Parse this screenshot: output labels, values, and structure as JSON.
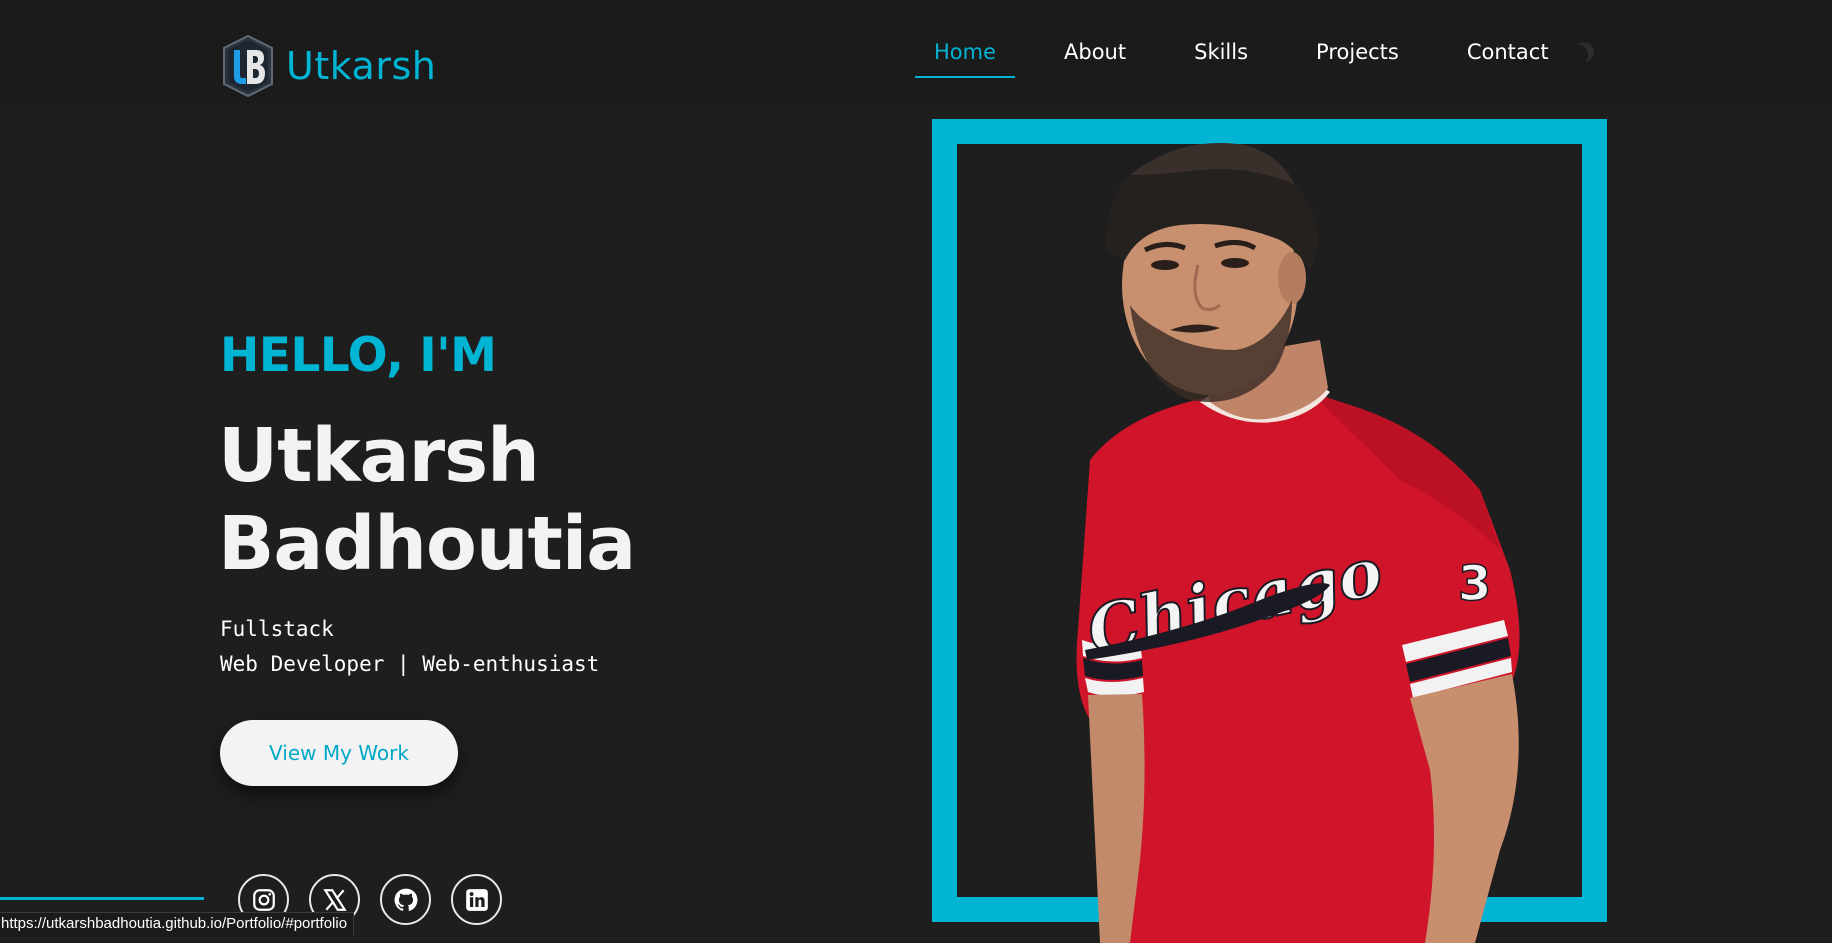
{
  "header": {
    "logo_text": "Utkarsh",
    "nav": [
      {
        "label": "Home",
        "active": true
      },
      {
        "label": "About",
        "active": false
      },
      {
        "label": "Skills",
        "active": false
      },
      {
        "label": "Projects",
        "active": false
      },
      {
        "label": "Contact",
        "active": false
      }
    ],
    "theme_toggle_icon": "moon-icon"
  },
  "hero": {
    "greeting": "HELLO, I'M",
    "name_line1": "Utkarsh",
    "name_line2": "Badhoutia",
    "role_line1": "Fullstack",
    "role_line2": "Web Developer | Web-enthusiast",
    "cta_label": "View My Work"
  },
  "social": [
    {
      "name": "instagram",
      "icon": "instagram-icon"
    },
    {
      "name": "x",
      "icon": "x-icon"
    },
    {
      "name": "github",
      "icon": "github-icon"
    },
    {
      "name": "linkedin",
      "icon": "linkedin-icon"
    }
  ],
  "status_bar": {
    "url": "https://utkarshbadhoutia.github.io/Portfolio/#portfolio"
  },
  "colors": {
    "accent": "#00b4d3",
    "background": "#1e1e1e",
    "header": "#1b1b1b",
    "text": "#f3f3f3"
  }
}
